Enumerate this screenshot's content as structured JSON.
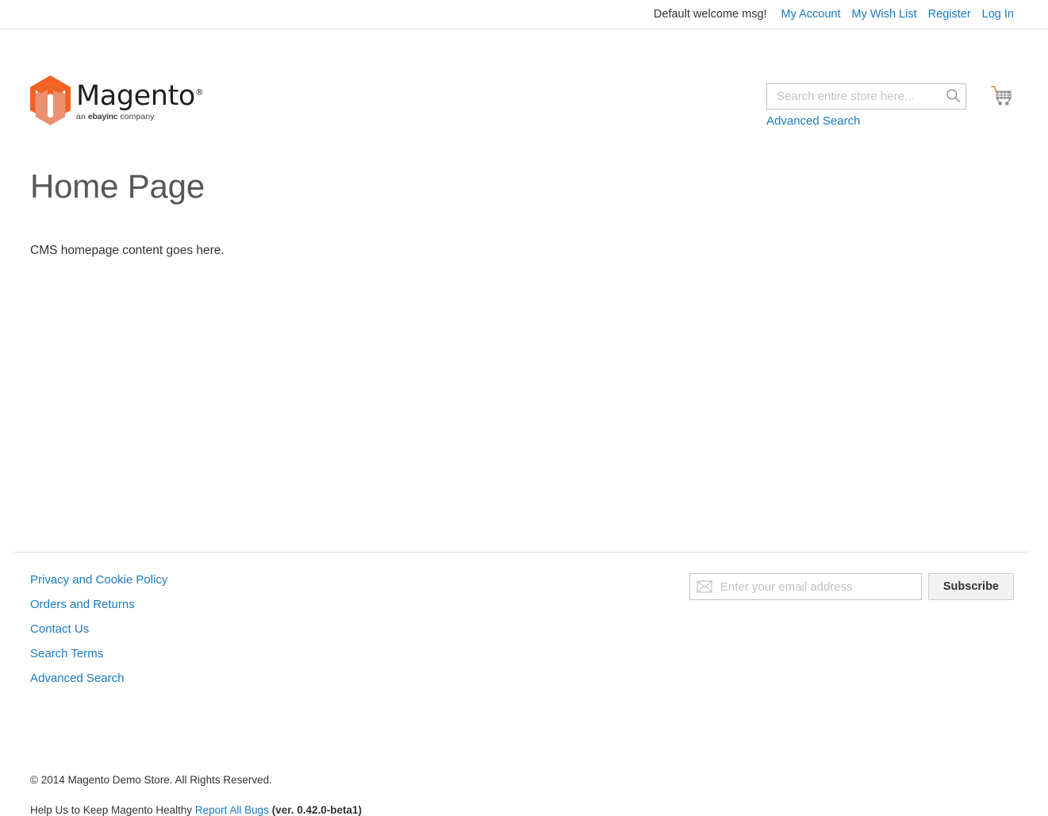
{
  "top_panel": {
    "welcome_message": "Default welcome msg!",
    "links": [
      {
        "label": "My Account"
      },
      {
        "label": "My Wish List"
      },
      {
        "label": "Register"
      },
      {
        "label": "Log In"
      }
    ]
  },
  "header": {
    "logo": {
      "wordmark": "Magento",
      "registered_mark": "®",
      "tagline_prefix": "an ",
      "tagline_brand": "ebay",
      "tagline_inc": "inc",
      "tagline_suffix": " company",
      "icon": "magento-logo-icon",
      "color_primary": "#f26322",
      "color_secondary": "#ea9171",
      "color_wordmark": "#231f20"
    },
    "search": {
      "placeholder": "Search entire store here...",
      "value": "",
      "submit_icon": "search-icon",
      "advanced_search_label": "Advanced Search"
    },
    "cart": {
      "icon": "shopping-cart-icon",
      "label": ""
    }
  },
  "main": {
    "page_title": "Home Page",
    "content": "CMS homepage content goes here."
  },
  "footer": {
    "links": [
      {
        "label": "Privacy and Cookie Policy"
      },
      {
        "label": "Orders and Returns"
      },
      {
        "label": "Contact Us"
      },
      {
        "label": "Search Terms"
      },
      {
        "label": "Advanced Search"
      }
    ],
    "newsletter": {
      "icon": "envelope-icon",
      "placeholder": "Enter your email address",
      "value": "",
      "subscribe_label": "Subscribe"
    },
    "copyright": "© 2014 Magento Demo Store. All Rights Reserved.",
    "bugs": {
      "prefix": "Help Us to Keep Magento Healthy ",
      "link_label": "Report All Bugs",
      "version": " (ver. 0.42.0-beta1)"
    }
  },
  "colors": {
    "link": "#1979c3",
    "text": "#333333",
    "title": "#575757",
    "border": "#c2c2c2",
    "divider": "#dcdcdc",
    "placeholder": "#c2c2c2"
  }
}
